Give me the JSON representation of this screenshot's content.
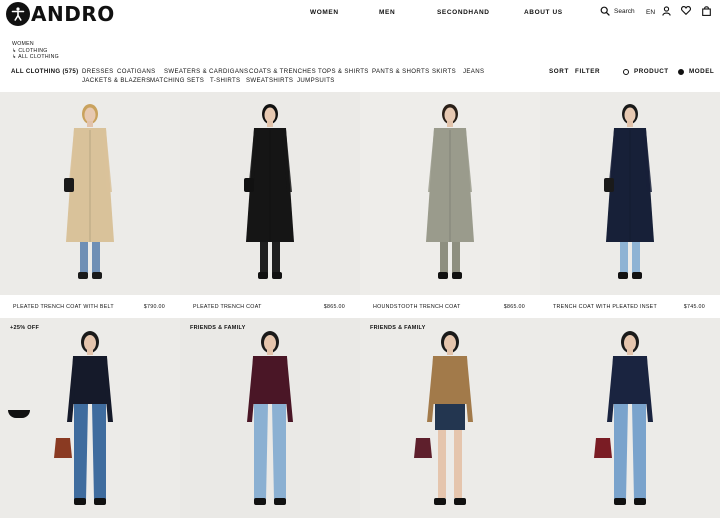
{
  "brand": {
    "name": "ANDRO"
  },
  "nav": [
    {
      "label": "WOMEN"
    },
    {
      "label": "MEN"
    },
    {
      "label": "SECONDHAND"
    },
    {
      "label": "ABOUT US"
    }
  ],
  "utility": {
    "search_label": "Search",
    "language": "EN"
  },
  "breadcrumb": [
    "WOMEN",
    "↳ CLOTHING",
    "↳ ALL CLOTHING"
  ],
  "categories": [
    {
      "label": "ALL CLOTHING (575)"
    },
    {
      "label": "DRESSES"
    },
    {
      "label": "COATIGANS"
    },
    {
      "label": "SWEATERS & CARDIGANS"
    },
    {
      "label": "COATS & TRENCHES"
    },
    {
      "label": "TOPS & SHIRTS"
    },
    {
      "label": "PANTS & SHORTS"
    },
    {
      "label": "SKIRTS"
    },
    {
      "label": "JEANS"
    },
    {
      "label": "JACKETS & BLAZERS"
    },
    {
      "label": "MATCHING SETS"
    },
    {
      "label": "T-SHIRTS"
    },
    {
      "label": "SWEATSHIRTS"
    },
    {
      "label": "JUMPSUITS"
    }
  ],
  "tools": {
    "sort": "SORT",
    "filter": "FILTER"
  },
  "view": {
    "product": "PRODUCT",
    "model": "MODEL",
    "selected": "MODEL"
  },
  "products": [
    {
      "name": "PLEATED TRENCH COAT WITH BELT",
      "price": "$790.00",
      "badge": "",
      "coat": "#d9c29a",
      "bottom": "#6f8fb5",
      "shoes": "#1a1a1a",
      "hair": "#c9a25e",
      "bag": "#1a1a1a"
    },
    {
      "name": "PLEATED TRENCH COAT",
      "price": "$865.00",
      "badge": "",
      "coat": "#151515",
      "bottom": "#1f1f1f",
      "shoes": "#111111",
      "hair": "#111111",
      "bag": "#111111"
    },
    {
      "name": "HOUNDSTOOTH TRENCH COAT",
      "price": "$865.00",
      "badge": "",
      "coat": "#9a9b8c",
      "bottom": "#8e8f80",
      "shoes": "#111111",
      "hair": "#2a2018",
      "bag": ""
    },
    {
      "name": "TRENCH COAT WITH PLEATED INSET",
      "price": "$745.00",
      "badge": "",
      "coat": "#172038",
      "bottom": "#8eb3d4",
      "shoes": "#111111",
      "hair": "#1a1a1a",
      "bag": "#1a1a1a"
    },
    {
      "name": "",
      "price": "",
      "badge": "+25% OFF",
      "coat": "#151a2a",
      "bottom": "#3f6c9e",
      "shoes": "#111111",
      "hair": "#1a1a1a",
      "bag": "#8a3a22"
    },
    {
      "name": "",
      "price": "",
      "badge": "FRIENDS & FAMILY",
      "coat": "#4a1626",
      "bottom": "#8bb0d2",
      "shoes": "#111111",
      "hair": "#1a1a1a",
      "bag": ""
    },
    {
      "name": "",
      "price": "",
      "badge": "FRIENDS & FAMILY",
      "coat": "#a27a4a",
      "bottom": "#233650",
      "shoes": "#111111",
      "hair": "#1a1a1a",
      "bag": "#5e1f2c"
    },
    {
      "name": "",
      "price": "",
      "badge": "",
      "coat": "#1a2440",
      "bottom": "#7aa3cc",
      "shoes": "#111111",
      "hair": "#1a1a1a",
      "bag": "#7a1c24"
    }
  ]
}
